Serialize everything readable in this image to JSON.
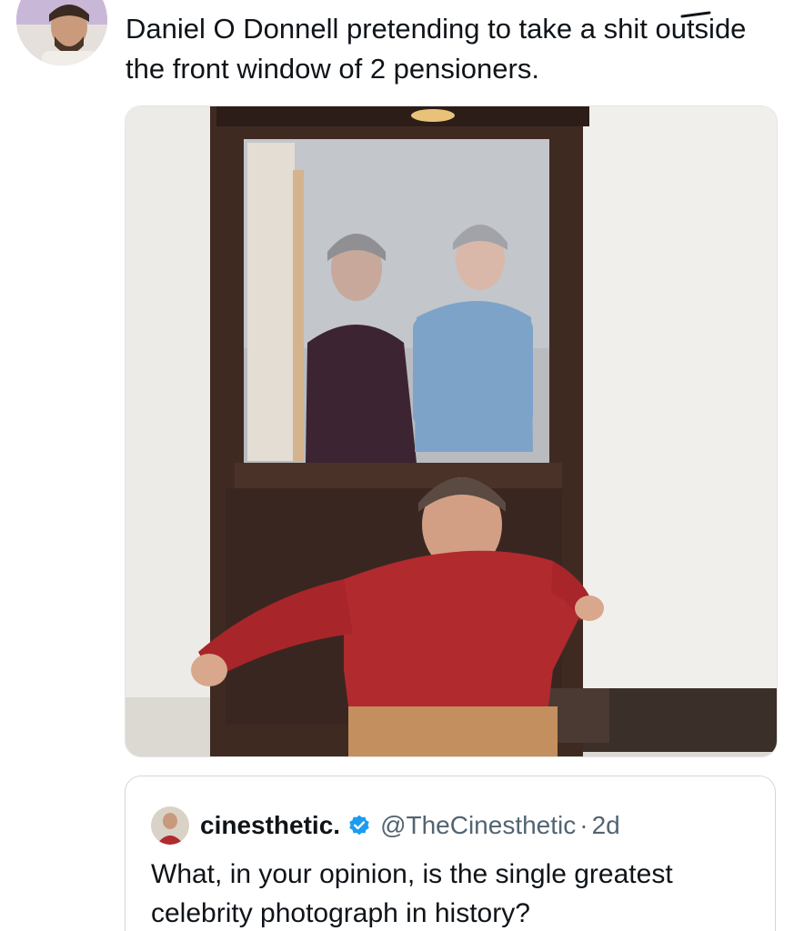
{
  "tweet": {
    "text": "Daniel O Donnell pretending to take a shit outside the front window of 2 pensioners.",
    "avatar_icon": "user-avatar-photo",
    "image_description": "man-crouching-in-front-of-window-photo"
  },
  "quoted_tweet": {
    "display_name": "cinesthetic.",
    "verified": true,
    "handle": "@TheCinesthetic",
    "separator": "·",
    "time": "2d",
    "text": "What, in your opinion, is the single greatest celebrity photograph in history?",
    "avatar_icon": "quoted-user-avatar"
  },
  "colors": {
    "text": "#0f1419",
    "secondary_text": "#536471",
    "border": "#cfd9de",
    "verified_blue": "#1d9bf0"
  }
}
